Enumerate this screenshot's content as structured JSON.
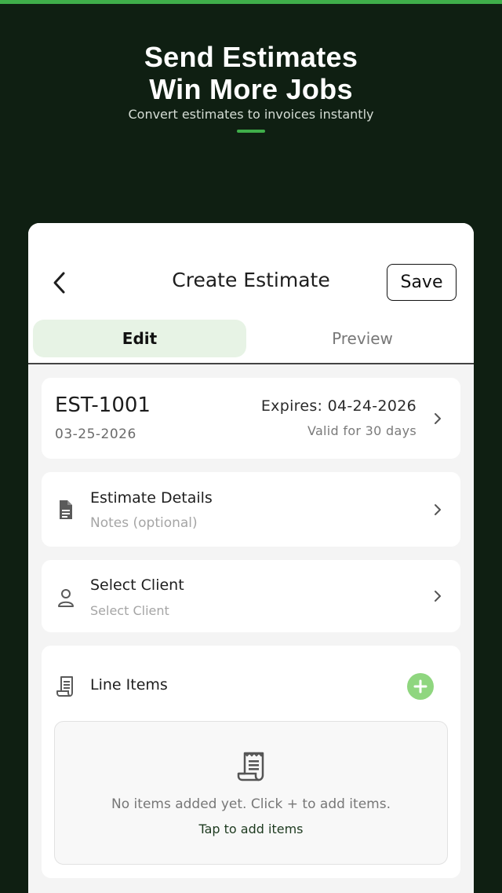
{
  "promo": {
    "title_line1": "Send Estimates",
    "title_line2": "Win More Jobs",
    "subtitle": "Convert estimates to invoices instantly"
  },
  "header": {
    "title": "Create Estimate",
    "save_label": "Save",
    "back_icon": "chevron-left-icon"
  },
  "tabs": [
    {
      "label": "Edit",
      "active": true
    },
    {
      "label": "Preview",
      "active": false
    }
  ],
  "estimate": {
    "number": "EST-1001",
    "date": "03-25-2026",
    "expires": "Expires: 04-24-2026",
    "valid": "Valid for 30 days"
  },
  "details": {
    "title": "Estimate Details",
    "subtitle": "Notes (optional)",
    "icon": "document-icon"
  },
  "client": {
    "title": "Select Client",
    "subtitle": "Select Client",
    "icon": "person-icon"
  },
  "line_items": {
    "title": "Line Items",
    "icon": "receipt-icon",
    "empty_text": "No items added yet. Click + to add items.",
    "empty_link": "Tap to add items"
  },
  "colors": {
    "background": "#0f1f12",
    "accent": "#3fae4a",
    "add_button": "#8fd67f",
    "active_tab": "#e7f3e5"
  }
}
